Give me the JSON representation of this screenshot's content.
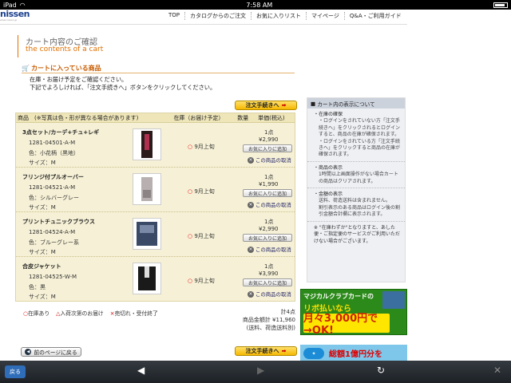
{
  "status": {
    "device": "iPad",
    "time": "7:58 AM"
  },
  "logo": {
    "text": "nissen",
    "url": "www.nissen.jp"
  },
  "nav": [
    "TOP",
    "カタログからのご注文",
    "お気に入りリスト",
    "マイページ",
    "Q&A・ご利用ガイド"
  ],
  "page": {
    "title_ja": "カート内容のご確認",
    "title_en": "the contents of a cart"
  },
  "section": {
    "title": "カートに入っている商品"
  },
  "intro": {
    "line1": "在庫・お届け予定をご確認ください。",
    "line2": "下記でよろしければ、「注文手続きへ」ボタンをクリックしてください。"
  },
  "proceed_label": "注文手続きへ",
  "table": {
    "headers": {
      "product": "商品　(※写真は色・形が異なる場合があります)",
      "stock": "在庫（お届け予定）",
      "qty": "数量",
      "price": "単価(税込)"
    },
    "fav_label": "お気に入りに追加",
    "remove_label": "この商品の取消",
    "rows": [
      {
        "name": "3点セット/カーデ+チュ+レギ",
        "code": "1281-04501-A-M",
        "color": "色：小花柄（黒地）",
        "size": "サイズ：M",
        "stock": "9月上旬",
        "qty": "1点",
        "price": "¥2,990"
      },
      {
        "name": "フリンジ付プルオーバー",
        "code": "1281-04521-A-M",
        "color": "色：シルバーグレー",
        "size": "サイズ：M",
        "stock": "9月上旬",
        "qty": "1点",
        "price": "¥1,990"
      },
      {
        "name": "プリントチュニックブラウス",
        "code": "1281-04524-A-M",
        "color": "色：ブルーグレー系",
        "size": "サイズ：M",
        "stock": "9月上旬",
        "qty": "1点",
        "price": "¥2,990"
      },
      {
        "name": "合皮ジャケット",
        "code": "1281-04525-W-M",
        "color": "色：黒",
        "size": "サイズ：M",
        "stock": "9月上旬",
        "qty": "1点",
        "price": "¥3,990"
      }
    ]
  },
  "legend": {
    "in_stock": "在庫あり",
    "arrival": "入荷次第のお届け",
    "soldout": "売切れ・受付終了"
  },
  "totals": {
    "count": "計4点",
    "amount": "商品金額計 ¥11,960",
    "note": "(送料、荷造送料別)"
  },
  "back_label": "前のページに戻る",
  "side": {
    "header": "カート内の表示について",
    "items": [
      {
        "title": "・在庫の確保",
        "lines": [
          "・ログインをされていない方「注文手続きへ」をクリックされるとログインすると、商品の在庫が確保されます。",
          "・ログインをされている方「注文手続きへ」をクリックすると商品の在庫が確保されます。"
        ]
      },
      {
        "title": "・商品の表示",
        "lines": [
          "1時間以上画面操作がない場合カートの商品はクリアされます。"
        ]
      },
      {
        "title": "・金額の表示",
        "lines": [
          "送料、荷造送料は含まれません。",
          "割引表示のある商品はログイン後の割引金額合計欄に表示されます。"
        ]
      }
    ],
    "note": "※ \"在庫わずか\"となりますと、あした便・ご指定便のサービスがご利用いただけない場合がございます。"
  },
  "banner1": {
    "line1": "マジカルクラブカードの",
    "line2": "リボ払いなら",
    "line3": "月々3,000円で→OK!"
  },
  "banner2": {
    "text": "総額1億円分を"
  },
  "toolbar": {
    "home": "戻る"
  }
}
